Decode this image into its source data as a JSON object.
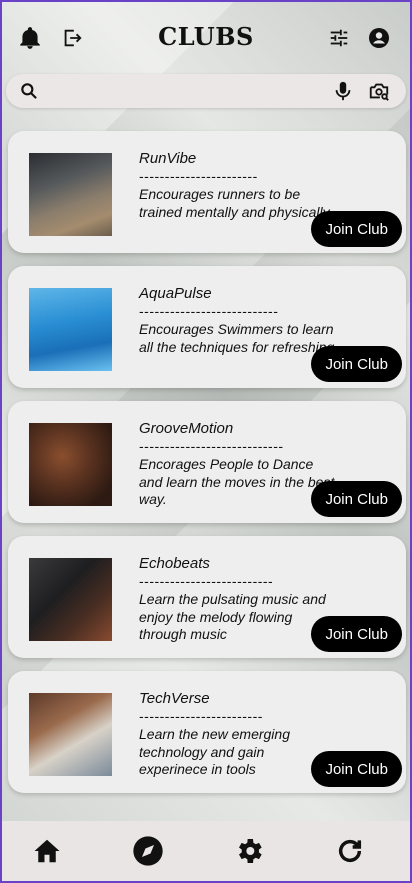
{
  "header": {
    "title": "CLUBS",
    "icons": [
      "bell-icon",
      "logout-icon",
      "filter-icon",
      "account-icon"
    ]
  },
  "search": {
    "placeholder": "",
    "icons": [
      "search-icon",
      "mic-icon",
      "camera-search-icon"
    ]
  },
  "clubs": [
    {
      "name": "RunVibe",
      "dashes": "-----------------------",
      "description": " Encourages runners to be trained mentally and physically.",
      "button": "Join Club"
    },
    {
      "name": "AquaPulse",
      "dashes": "---------------------------",
      "description": "Encourages Swimmers to learn all the techniques for refreshing",
      "button": "Join Club"
    },
    {
      "name": "GrooveMotion",
      "dashes": "----------------------------",
      "description": "Encorages People to Dance and learn the moves in the best way.",
      "button": "Join Club"
    },
    {
      "name": "Echobeats",
      "dashes": "--------------------------",
      "description": "Learn the pulsating music and enjoy the melody flowing through music",
      "button": "Join Club"
    },
    {
      "name": "TechVerse",
      "dashes": "------------------------",
      "description": "Learn the new emerging technology and gain experinece in tools",
      "button": "Join Club"
    }
  ],
  "nav": {
    "icons": [
      "home-icon",
      "compass-icon",
      "settings-icon",
      "refresh-icon"
    ]
  },
  "colors": {
    "accent_border": "#6a42c8",
    "button_bg": "#000000",
    "card_bg": "#eeeeee"
  }
}
